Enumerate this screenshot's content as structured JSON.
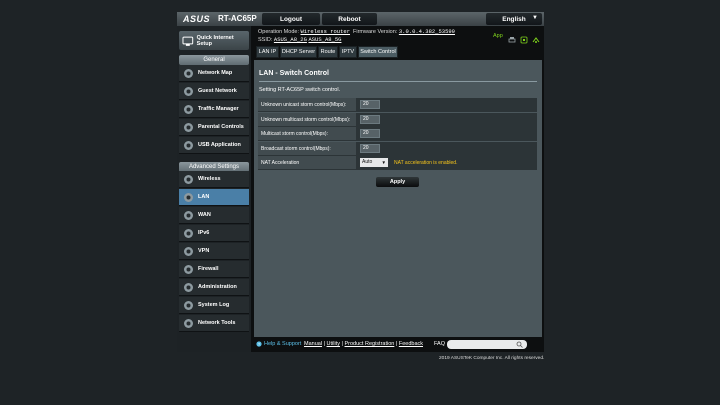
{
  "header": {
    "brand": "ASUS",
    "model": "RT-AC65P",
    "logout_label": "Logout",
    "reboot_label": "Reboot",
    "language": "English",
    "operation_mode_label": "Operation Mode:",
    "operation_mode_value": "Wireless router",
    "firmware_label": "Firmware Version:",
    "firmware_value": "3.0.0.4.382_53599",
    "ssid_label": "SSID:",
    "ssid_24": "ASUS_A8_2G",
    "ssid_5": "ASUS_A8_5G",
    "app_label": "App"
  },
  "sidebar": {
    "quick_setup": "Quick Internet Setup",
    "general_header": "General",
    "general_items": [
      {
        "label": "Network Map",
        "icon": "network-map-icon"
      },
      {
        "label": "Guest Network",
        "icon": "guest-network-icon"
      },
      {
        "label": "Traffic Manager",
        "icon": "traffic-manager-icon"
      },
      {
        "label": "Parental Controls",
        "icon": "parental-controls-icon"
      },
      {
        "label": "USB Application",
        "icon": "usb-icon"
      }
    ],
    "advanced_header": "Advanced Settings",
    "advanced_items": [
      {
        "label": "Wireless",
        "icon": "wireless-icon"
      },
      {
        "label": "LAN",
        "icon": "lan-icon"
      },
      {
        "label": "WAN",
        "icon": "wan-icon"
      },
      {
        "label": "IPv6",
        "icon": "ipv6-icon"
      },
      {
        "label": "VPN",
        "icon": "vpn-icon"
      },
      {
        "label": "Firewall",
        "icon": "firewall-icon"
      },
      {
        "label": "Administration",
        "icon": "administration-icon"
      },
      {
        "label": "System Log",
        "icon": "system-log-icon"
      },
      {
        "label": "Network Tools",
        "icon": "network-tools-icon"
      }
    ],
    "active_item": "LAN"
  },
  "tabs": [
    {
      "label": "LAN IP"
    },
    {
      "label": "DHCP Server"
    },
    {
      "label": "Route"
    },
    {
      "label": "IPTV"
    },
    {
      "label": "Switch Control",
      "active": true
    }
  ],
  "main": {
    "title": "LAN - Switch Control",
    "description": "Setting RT-AC65P switch control.",
    "fields": [
      {
        "label": "Unknown unicast storm control(Mbps):",
        "value": "20"
      },
      {
        "label": "Unknown multicast storm control(Mbps):",
        "value": "20"
      },
      {
        "label": "Multicast storm control(Mbps):",
        "value": "20"
      },
      {
        "label": "Broadcast storm control(Mbps):",
        "value": "20"
      }
    ],
    "nat": {
      "label": "NAT Acceleration",
      "selected": "Auto",
      "note": "NAT acceleration is enabled."
    },
    "apply_label": "Apply"
  },
  "footer": {
    "help": "Help & Support",
    "links": [
      "Manual",
      "Utility",
      "Product Registration",
      "Feedback"
    ],
    "faq_label": "FAQ",
    "copyright": "2019 ASUSTeK Computer Inc. All rights reserved."
  },
  "colors": {
    "accent_active": "#4a7fa7",
    "panel": "#4b575c",
    "note": "#f7c51b",
    "help": "#5cc0e8",
    "app": "#7fd31c"
  }
}
